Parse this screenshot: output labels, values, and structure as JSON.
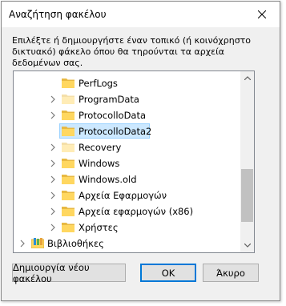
{
  "dialog": {
    "title": "Αναζήτηση φακέλου",
    "instructions": "Επιλέξτε ή δημιουργήστε έναν τοπικό (ή κοινόχρηστο δικτυακό) φάκελο όπου θα τηρούνται τα αρχεία δεδομένων σας."
  },
  "tree": {
    "items": [
      {
        "label": "PerfLogs",
        "expandable": false,
        "faded": false
      },
      {
        "label": "ProgramData",
        "expandable": true,
        "faded": true
      },
      {
        "label": "ProtocolloData",
        "expandable": true,
        "faded": false
      },
      {
        "label": "ProtocolloData2",
        "expandable": false,
        "faded": false,
        "selected": true
      },
      {
        "label": "Recovery",
        "expandable": true,
        "faded": true
      },
      {
        "label": "Windows",
        "expandable": true,
        "faded": false
      },
      {
        "label": "Windows.old",
        "expandable": true,
        "faded": false
      },
      {
        "label": "Αρχεία Εφαρμογών",
        "expandable": true,
        "faded": false
      },
      {
        "label": "Αρχεία εφαρμογών (x86)",
        "expandable": true,
        "faded": false
      },
      {
        "label": "Χρήστες",
        "expandable": true,
        "faded": false
      },
      {
        "label": "Βιβλιοθήκες",
        "expandable": true,
        "faded": false,
        "library": true
      }
    ]
  },
  "buttons": {
    "new_folder": "Δημιουργία νέου φακέλου",
    "ok": "OK",
    "cancel": "Άκυρο"
  },
  "colors": {
    "selection_bg": "#cce8ff",
    "selection_border": "#99d1ff",
    "folder_yellow": "#ffd760",
    "accent": "#0078d7"
  }
}
